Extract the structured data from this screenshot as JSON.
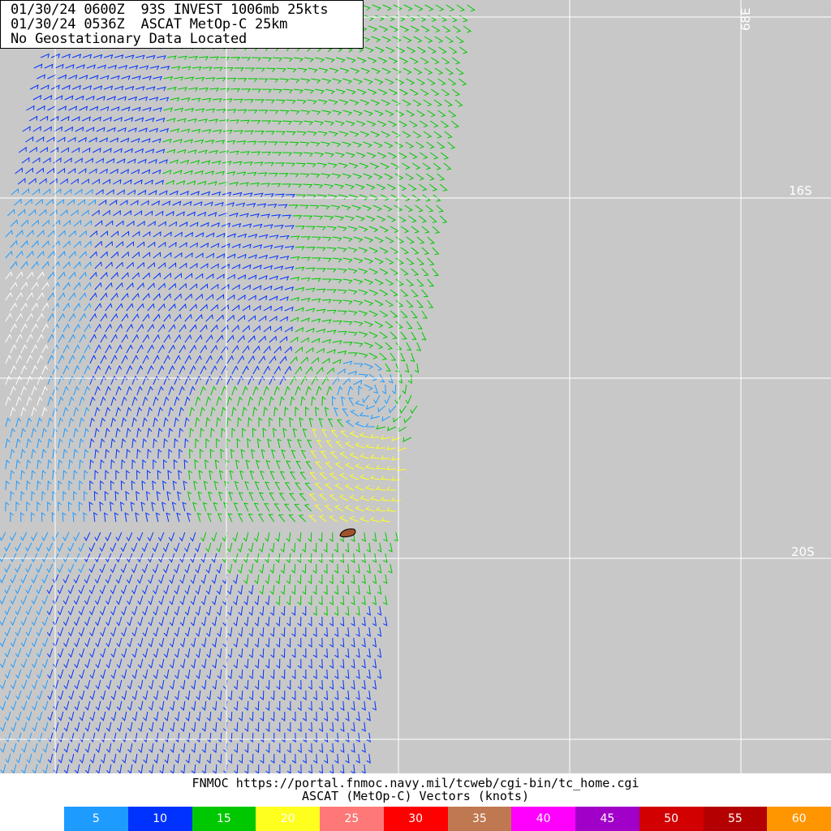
{
  "header": {
    "line1": "01/30/24 0600Z  93S INVEST 1006mb 25kts",
    "line2": "01/30/24 0536Z  ASCAT MetOp-C 25km",
    "line3": "No Geostationary Data Located"
  },
  "grid_labels": {
    "lon_68e": "68E",
    "lat_16s": "16S",
    "lat_20s": "20S"
  },
  "footer": {
    "source": "FNMOC https://portal.fnmoc.navy.mil/tcweb/cgi-bin/tc_home.cgi",
    "caption": "ASCAT (MetOp-C) Vectors (knots)"
  },
  "legend": [
    {
      "label": "5",
      "color": "#1e9bff"
    },
    {
      "label": "10",
      "color": "#0032ff"
    },
    {
      "label": "15",
      "color": "#00c800"
    },
    {
      "label": "20",
      "color": "#ffff1e"
    },
    {
      "label": "25",
      "color": "#ff7878"
    },
    {
      "label": "30",
      "color": "#ff0000"
    },
    {
      "label": "35",
      "color": "#c07850"
    },
    {
      "label": "40",
      "color": "#ff00ff"
    },
    {
      "label": "45",
      "color": "#a000c8"
    },
    {
      "label": "50",
      "color": "#d20000"
    },
    {
      "label": "55",
      "color": "#b40000"
    },
    {
      "label": "60",
      "color": "#ff9600"
    }
  ],
  "colors": {
    "background": "#c8c8c8",
    "grid": "#ffffff",
    "land": "#a0522d"
  }
}
